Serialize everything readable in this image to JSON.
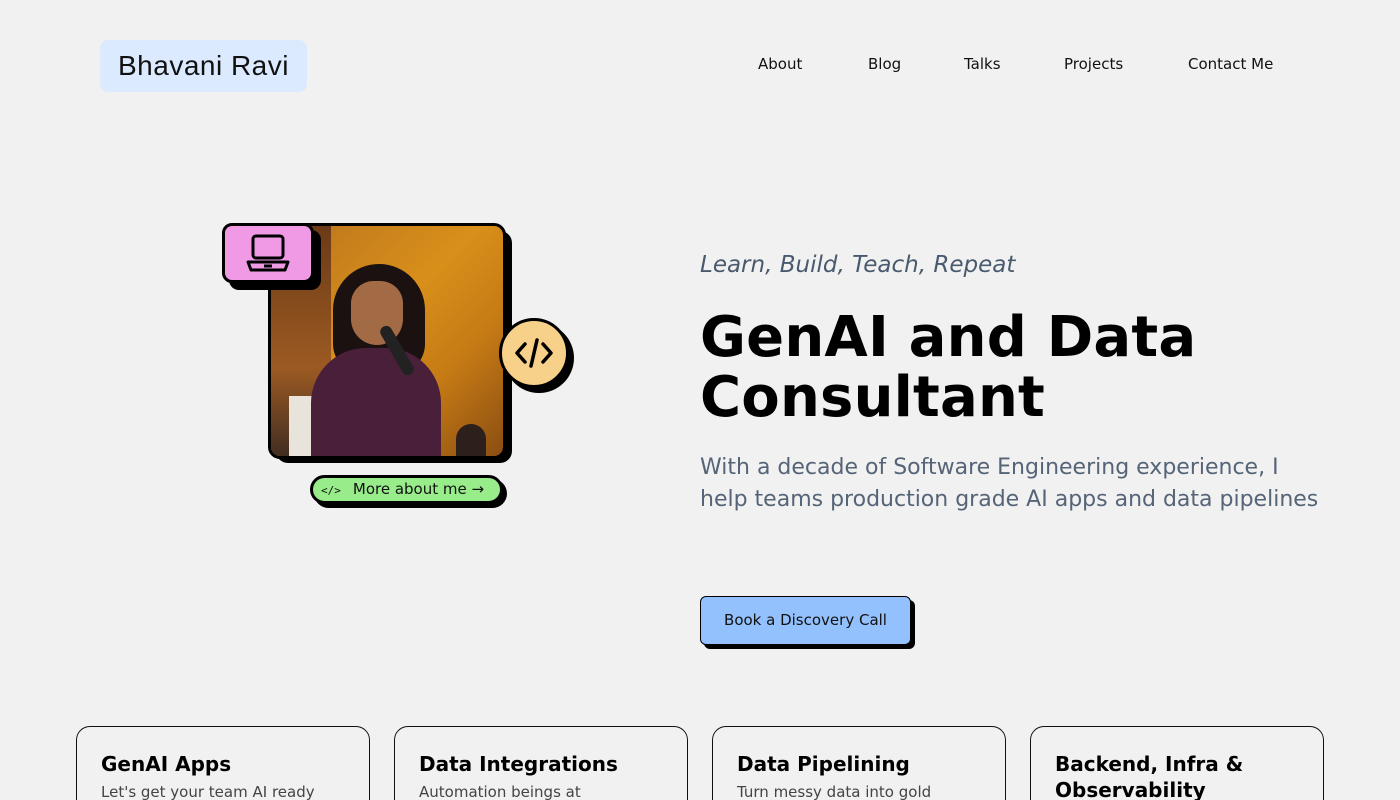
{
  "header": {
    "logo": "Bhavani Ravi",
    "nav": [
      {
        "label": "About"
      },
      {
        "label": "Blog"
      },
      {
        "label": "Talks"
      },
      {
        "label": "Projects"
      },
      {
        "label": "Contact Me"
      }
    ]
  },
  "hero": {
    "tagline": "Learn, Build, Teach, Repeat",
    "headline": "GenAI and Data Consultant",
    "subtext": "With a decade of Software Engineering experience, I help teams production grade AI apps and data pipelines",
    "cta_label": "Book a Discovery Call",
    "more_label": "More about me →",
    "icons": [
      "laptop-icon",
      "code-icon"
    ],
    "colors": {
      "laptop_badge": "#f09ae6",
      "code_badge": "#f7d08a",
      "more_button": "#98ec8a",
      "cta": "#93c1fd",
      "logo_bg": "#dbeafe"
    }
  },
  "services": [
    {
      "title": "GenAI Apps",
      "desc": "Let's get your team AI ready"
    },
    {
      "title": "Data Integrations",
      "desc": "Automation beings at"
    },
    {
      "title": "Data Pipelining",
      "desc": "Turn messy data into gold"
    },
    {
      "title": "Backend, Infra & Observability",
      "desc": ""
    }
  ]
}
